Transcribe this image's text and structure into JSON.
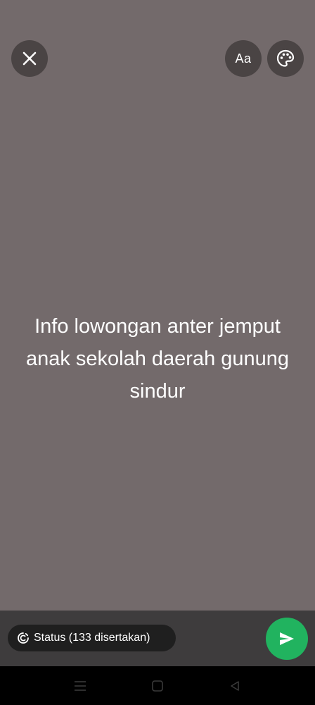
{
  "top_bar": {
    "close_icon": "close-icon",
    "font_label": "Aa",
    "palette_icon": "palette-icon"
  },
  "status": {
    "text": "Info lowongan anter jemput anak sekolah daerah gunung sindur",
    "background_color": "#736a6b",
    "text_color": "#ffffff"
  },
  "bottom_bar": {
    "audience_label": "Status (133 disertakan)",
    "audience_icon": "status-icon",
    "send_icon": "send-icon",
    "send_color": "#21b35f"
  },
  "nav_bar": {
    "items": [
      {
        "icon": "menu-icon"
      },
      {
        "icon": "home-icon"
      },
      {
        "icon": "back-icon"
      }
    ]
  }
}
